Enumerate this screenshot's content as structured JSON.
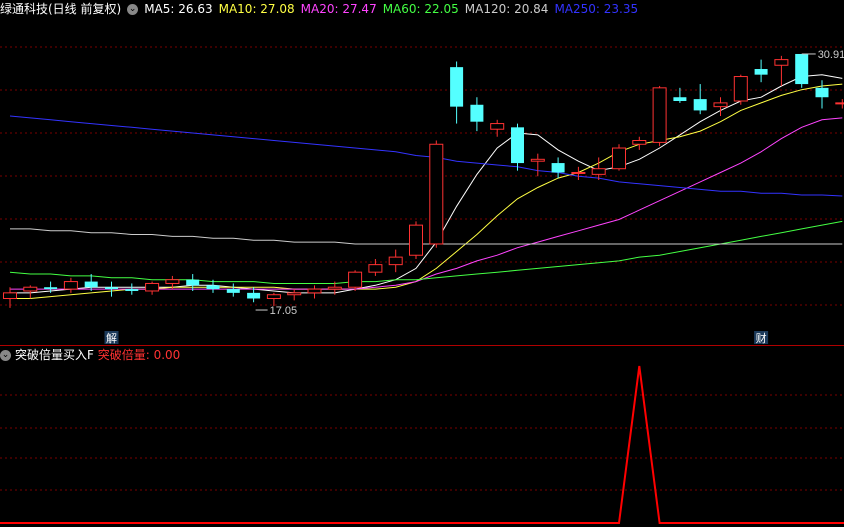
{
  "header": {
    "title": "绿通科技(日线 前复权)",
    "ma": [
      {
        "label": "MA5: 26.63",
        "color": "#ffffff"
      },
      {
        "label": "MA10: 27.08",
        "color": "#ffff44"
      },
      {
        "label": "MA20: 27.47",
        "color": "#ff44ff"
      },
      {
        "label": "MA60: 22.05",
        "color": "#44ff44"
      },
      {
        "label": "MA120: 20.84",
        "color": "#cccccc"
      },
      {
        "label": "MA250: 23.35",
        "color": "#3333ff"
      }
    ]
  },
  "sub_header": {
    "indicator_name": "突破倍量买入F",
    "value_label": "突破倍量: 0.00"
  },
  "markers": {
    "jie": "解",
    "cai": "财",
    "low_label": "17.05",
    "high_label": "30.91"
  },
  "colors": {
    "up": "#ff3232",
    "down": "#54ffff",
    "grid": "#7a0000",
    "divider": "#b00000",
    "signal": "#ff0000"
  },
  "chart_data": [
    {
      "type": "candlestick",
      "title": "绿通科技(日线 前复权)",
      "price_range": [
        15.8,
        32.6
      ],
      "ohlc": [
        [
          17.9,
          18.5,
          17.4,
          18.2
        ],
        [
          18.3,
          18.6,
          17.9,
          18.5
        ],
        [
          18.5,
          18.8,
          18.2,
          18.4
        ],
        [
          18.4,
          19.0,
          18.2,
          18.8
        ],
        [
          18.8,
          19.2,
          18.3,
          18.5
        ],
        [
          18.5,
          18.8,
          18.0,
          18.4
        ],
        [
          18.4,
          18.7,
          18.1,
          18.3
        ],
        [
          18.3,
          18.8,
          18.1,
          18.7
        ],
        [
          18.7,
          19.1,
          18.4,
          18.9
        ],
        [
          18.9,
          19.2,
          18.3,
          18.6
        ],
        [
          18.6,
          18.9,
          18.2,
          18.4
        ],
        [
          18.4,
          18.7,
          18.0,
          18.2
        ],
        [
          18.2,
          18.5,
          17.7,
          17.9
        ],
        [
          17.9,
          18.2,
          17.5,
          18.1
        ],
        [
          18.1,
          18.4,
          17.8,
          18.2
        ],
        [
          18.2,
          18.6,
          17.9,
          18.4
        ],
        [
          18.4,
          18.8,
          18.1,
          18.5
        ],
        [
          18.5,
          19.4,
          18.3,
          19.3
        ],
        [
          19.3,
          20.0,
          19.1,
          19.7
        ],
        [
          19.7,
          20.5,
          19.3,
          20.1
        ],
        [
          20.2,
          22.0,
          20.0,
          21.8
        ],
        [
          20.8,
          26.3,
          20.6,
          26.1
        ],
        [
          30.2,
          30.5,
          27.2,
          28.1
        ],
        [
          28.2,
          28.6,
          26.8,
          27.3
        ],
        [
          26.9,
          27.4,
          26.5,
          27.2
        ],
        [
          27.0,
          27.2,
          24.7,
          25.1
        ],
        [
          25.2,
          25.6,
          24.4,
          25.3
        ],
        [
          25.1,
          25.4,
          24.3,
          24.6
        ],
        [
          24.6,
          24.9,
          24.2,
          24.6
        ],
        [
          24.5,
          25.4,
          24.2,
          24.8
        ],
        [
          24.8,
          26.1,
          24.7,
          25.9
        ],
        [
          26.1,
          26.5,
          25.8,
          26.3
        ],
        [
          26.2,
          29.2,
          26.0,
          29.1
        ],
        [
          28.6,
          29.1,
          28.3,
          28.4
        ],
        [
          28.5,
          29.3,
          27.7,
          27.9
        ],
        [
          28.1,
          28.6,
          27.6,
          28.3
        ],
        [
          28.4,
          29.8,
          28.2,
          29.7
        ],
        [
          30.1,
          30.6,
          29.4,
          29.8
        ],
        [
          30.3,
          30.8,
          29.2,
          30.6
        ],
        [
          30.9,
          30.9,
          29.1,
          29.3
        ],
        [
          29.1,
          29.5,
          28.0,
          28.6
        ],
        [
          28.3,
          28.5,
          28.0,
          28.3
        ]
      ],
      "ma_series": [
        {
          "name": "MA5",
          "last": 26.63,
          "values": [
            18.2,
            18.2,
            18.3,
            18.4,
            18.5,
            18.5,
            18.5,
            18.5,
            18.5,
            18.6,
            18.6,
            18.5,
            18.4,
            18.3,
            18.2,
            18.2,
            18.2,
            18.4,
            18.6,
            18.9,
            19.5,
            20.9,
            22.8,
            24.5,
            25.9,
            26.7,
            26.6,
            25.8,
            25.2,
            24.7,
            24.9,
            25.3,
            25.9,
            26.6,
            27.3,
            27.9,
            28.4,
            28.6,
            29.2,
            29.7,
            29.8,
            29.6
          ]
        },
        {
          "name": "MA10",
          "last": 27.08,
          "values": [
            17.9,
            17.9,
            18.0,
            18.1,
            18.2,
            18.3,
            18.4,
            18.4,
            18.5,
            18.5,
            18.5,
            18.5,
            18.5,
            18.5,
            18.4,
            18.4,
            18.4,
            18.4,
            18.4,
            18.5,
            18.8,
            19.5,
            20.4,
            21.3,
            22.3,
            23.2,
            23.8,
            24.3,
            24.6,
            25.1,
            25.7,
            26.1,
            26.3,
            26.5,
            26.8,
            27.3,
            27.9,
            28.3,
            28.7,
            29.0,
            29.2,
            29.3
          ]
        },
        {
          "name": "MA20",
          "last": 27.47,
          "values": [
            18.4,
            18.4,
            18.4,
            18.4,
            18.4,
            18.4,
            18.4,
            18.4,
            18.4,
            18.4,
            18.4,
            18.4,
            18.4,
            18.4,
            18.4,
            18.4,
            18.4,
            18.4,
            18.5,
            18.6,
            18.8,
            19.2,
            19.5,
            19.9,
            20.2,
            20.6,
            20.9,
            21.2,
            21.5,
            21.8,
            22.1,
            22.6,
            23.1,
            23.6,
            24.1,
            24.6,
            25.1,
            25.7,
            26.4,
            27.0,
            27.4,
            27.5
          ]
        },
        {
          "name": "MA60",
          "last": 22.05,
          "values": [
            19.3,
            19.2,
            19.2,
            19.1,
            19.1,
            19.0,
            19.0,
            18.9,
            18.9,
            18.9,
            18.8,
            18.8,
            18.8,
            18.7,
            18.7,
            18.7,
            18.7,
            18.8,
            18.8,
            18.9,
            18.9,
            19.0,
            19.1,
            19.2,
            19.3,
            19.4,
            19.5,
            19.6,
            19.7,
            19.8,
            19.9,
            20.1,
            20.2,
            20.4,
            20.6,
            20.8,
            21.0,
            21.2,
            21.4,
            21.6,
            21.8,
            22.0
          ]
        },
        {
          "name": "MA120",
          "last": 20.84,
          "values": [
            21.6,
            21.6,
            21.5,
            21.5,
            21.4,
            21.4,
            21.3,
            21.3,
            21.2,
            21.2,
            21.1,
            21.1,
            21.0,
            21.0,
            20.9,
            20.9,
            20.9,
            20.8,
            20.8,
            20.8,
            20.8,
            20.8,
            20.8,
            20.8,
            20.8,
            20.8,
            20.8,
            20.8,
            20.8,
            20.8,
            20.8,
            20.8,
            20.8,
            20.8,
            20.8,
            20.8,
            20.8,
            20.8,
            20.8,
            20.8,
            20.8,
            20.8
          ]
        },
        {
          "name": "MA250",
          "last": 23.35,
          "values": [
            27.6,
            27.5,
            27.4,
            27.3,
            27.2,
            27.1,
            27.0,
            26.9,
            26.8,
            26.7,
            26.6,
            26.5,
            26.4,
            26.3,
            26.2,
            26.1,
            26.0,
            25.9,
            25.8,
            25.7,
            25.5,
            25.4,
            25.2,
            25.1,
            25.0,
            24.9,
            24.7,
            24.6,
            24.4,
            24.3,
            24.1,
            24.0,
            23.9,
            23.8,
            23.7,
            23.6,
            23.6,
            23.5,
            23.5,
            23.4,
            23.4,
            23.35
          ]
        }
      ]
    },
    {
      "type": "line",
      "title": "突破倍量买入F",
      "series": [
        {
          "name": "突破倍量",
          "values": [
            0,
            0,
            0,
            0,
            0,
            0,
            0,
            0,
            0,
            0,
            0,
            0,
            0,
            0,
            0,
            0,
            0,
            0,
            0,
            0,
            0,
            0,
            0,
            0,
            0,
            0,
            0,
            0,
            0,
            0,
            0,
            1,
            0,
            0,
            0,
            0,
            0,
            0,
            0,
            0,
            0,
            0
          ]
        }
      ]
    }
  ]
}
